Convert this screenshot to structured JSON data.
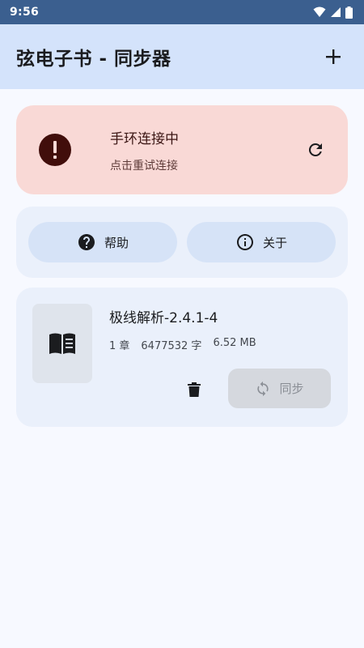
{
  "status_bar": {
    "time": "9:56",
    "icons": [
      "wifi-icon",
      "signal-icon",
      "battery-icon"
    ]
  },
  "app_bar": {
    "title": "弦电子书 - 同步器",
    "action_icon": "add-icon"
  },
  "connection": {
    "title": "手环连接中",
    "subtitle": "点击重试连接",
    "icon": "alert-icon",
    "action_icon": "refresh-icon"
  },
  "actions": {
    "help_label": "帮助",
    "about_label": "关于"
  },
  "book": {
    "title": "极线解析-2.4.1-4",
    "chapters": "1 章",
    "chars": "6477532 字",
    "size": "6.52 MB",
    "sync_label": "同步",
    "sync_enabled": false
  },
  "colors": {
    "status_bar": "#3b5f8f",
    "app_bar": "#d4e3fb",
    "error_container": "#f9d9d6",
    "card": "#eaf0fb",
    "pill": "#d6e3f7",
    "disabled_button": "#d5d8de"
  }
}
